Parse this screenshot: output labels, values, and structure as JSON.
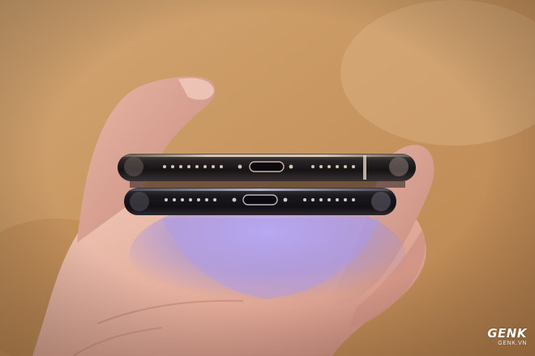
{
  "photo": {
    "subject_icons": [
      "hand-icon",
      "smartphone-icon",
      "smartphone-icon"
    ],
    "background_color": "#c99a66",
    "skin_color": "#e8b8a8",
    "phone_color": "#1c1a1c",
    "screen_glow_color": "#9a8de0"
  },
  "watermark": {
    "brand": "GENK",
    "domain": "GENK.VN"
  }
}
